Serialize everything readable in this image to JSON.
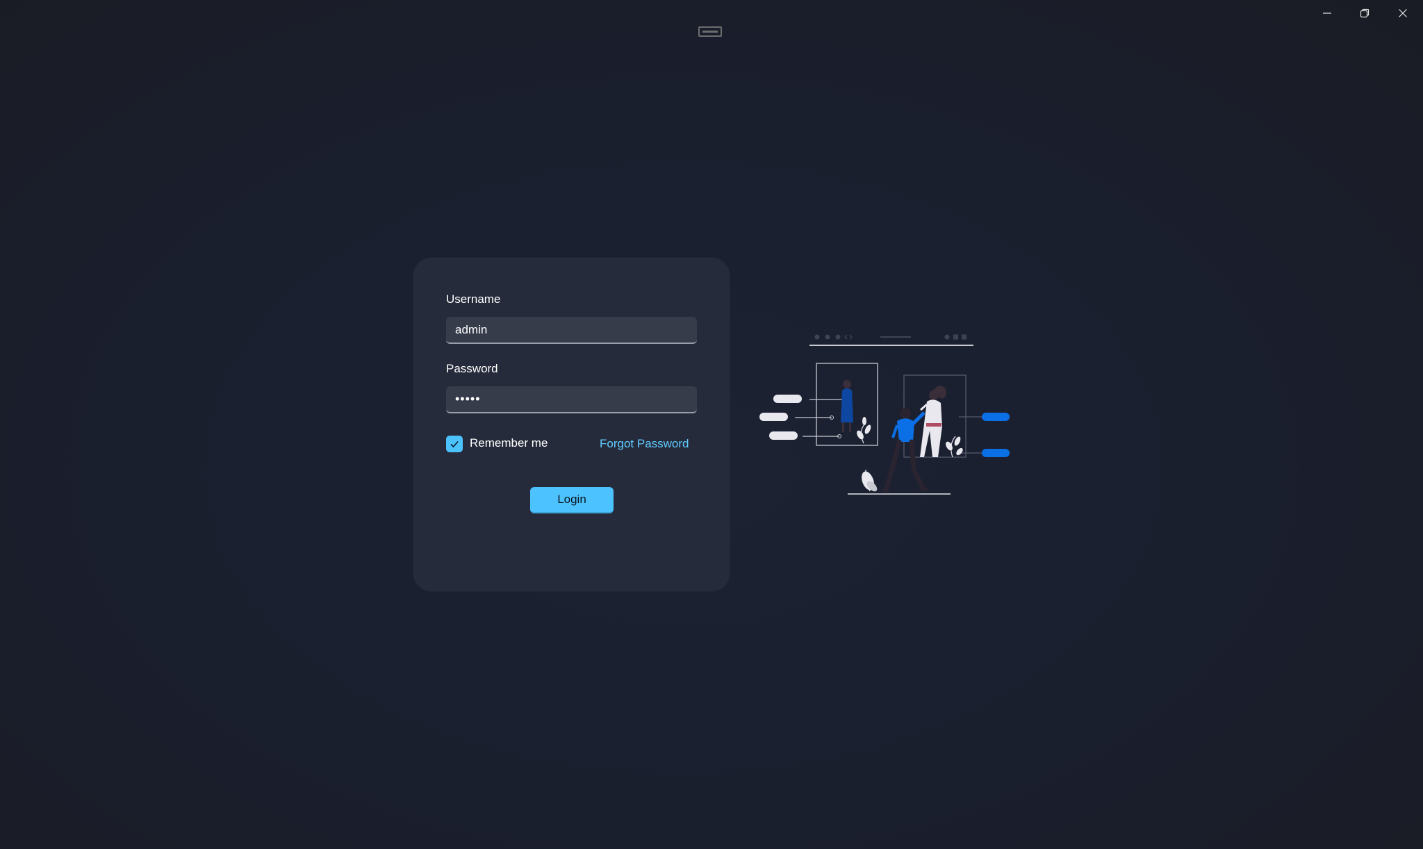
{
  "window": {
    "controls": {
      "minimize_icon": "minimize-icon",
      "maximize_icon": "restore-icon",
      "close_icon": "close-icon"
    }
  },
  "login": {
    "username_label": "Username",
    "username_value": "admin",
    "password_label": "Password",
    "password_value": "•••••",
    "remember_me_label": "Remember me",
    "remember_me_checked": true,
    "forgot_password_label": "Forgot Password",
    "login_button_label": "Login"
  },
  "colors": {
    "background": "#1a1f2e",
    "card": "#262b3b",
    "field": "#373c4b",
    "accent": "#4cc2ff",
    "link": "#60cdff",
    "illustration_accent": "#0b6fe6"
  },
  "illustration": {
    "icon": "people-interface-illustration"
  }
}
